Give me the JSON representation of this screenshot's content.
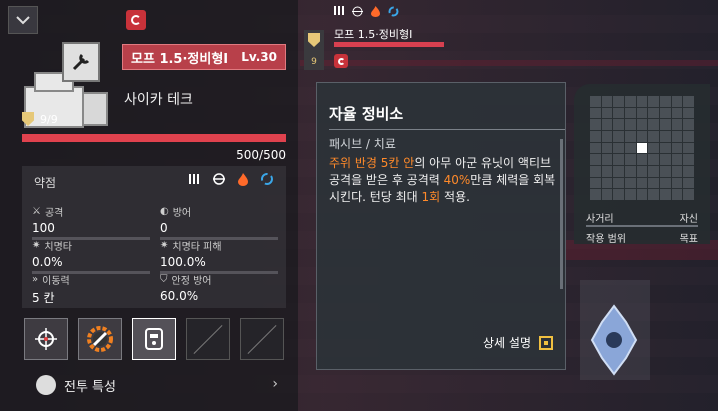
{
  "left_panel": {
    "unit_name": "모프 1.5·정비형I",
    "level": "Lv.30",
    "company": "사이카 테크",
    "shield_count": "9/9",
    "hp_text": "500/500",
    "hp_fraction": 1.0,
    "weakness_label": "약점",
    "weakness_icons": [
      "bullet-icon",
      "explosive-icon",
      "fire-icon",
      "electric-icon"
    ],
    "stats": {
      "attack_label": "공격",
      "attack_value": "100",
      "defense_label": "방어",
      "defense_value": "0",
      "crit_label": "치명타",
      "crit_value": "0.0%",
      "crit_dmg_label": "치명타 피해",
      "crit_dmg_value": "100.0%",
      "move_label": "이동력",
      "move_value": "5 칸",
      "stability_label": "안정 방어",
      "stability_value": "60.0%"
    },
    "skills": [
      "target-icon",
      "gear-wrench-icon",
      "robot-icon"
    ],
    "combat_traits": "전투 특성"
  },
  "unit2": {
    "name": "모프 1.5·정비형I",
    "shield": "9",
    "icons": [
      "bullet-icon",
      "explosive-icon",
      "fire-icon",
      "electric-icon"
    ]
  },
  "tooltip": {
    "title": "자율 정비소",
    "type": "패시브 / 치료",
    "desc_hl1": "주위 반경 5칸 안",
    "desc_1": "의 아무 아군 유닛이 액티브 공격을 받은 후 공격력 ",
    "desc_hl2": "40%",
    "desc_2": "만큼 체력을 회복시킨다. 턴당 최대 ",
    "desc_hl3": "1회",
    "desc_3": " 적용.",
    "detail": "상세 설명"
  },
  "range_panel": {
    "range_label": "사거리",
    "range_value": "자신",
    "area_label": "작용 범위",
    "area_value": "목표"
  },
  "colors": {
    "hp": "#e0424e",
    "highlight": "#ff8a2a",
    "banner": "#b8404a"
  }
}
